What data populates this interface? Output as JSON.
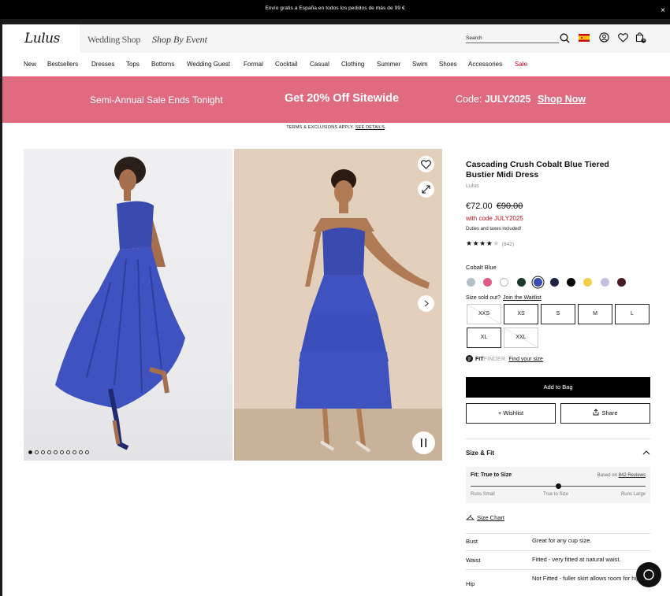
{
  "announcement": {
    "text": "Envío gratis a España en todos los pedidos de más de 99 €",
    "close": "×"
  },
  "header": {
    "logo": "Lulus",
    "tabs": [
      "Wedding Shop",
      "Shop By Event"
    ],
    "search_label": "Search",
    "bag_count": "0",
    "icons": [
      "search-icon",
      "spain-flag-icon",
      "account-icon",
      "heart-icon",
      "bag-icon"
    ]
  },
  "nav": [
    "New",
    "Bestsellers",
    "Dresses",
    "Tops",
    "Bottoms",
    "Wedding Guest",
    "Formal",
    "Cocktail",
    "Casual",
    "Clothing",
    "Summer",
    "Swim",
    "Shoes",
    "Accessories",
    "Sale"
  ],
  "promo": {
    "left": "Semi-Annual Sale Ends Tonight",
    "center": "Get 20% Off Sitewide",
    "code_label": "Code:",
    "code": "JULY2025",
    "cta": "Shop Now",
    "terms": "TERMS & EXCLUSIONS APPLY.",
    "terms_link": "SEE DETAILS"
  },
  "gallery": {
    "dot_count": 10,
    "active_dot": 0
  },
  "product": {
    "title": "Cascading Crush Cobalt Blue Tiered Bustier Midi Dress",
    "brand": "Lulus",
    "price": "€72.00",
    "original_price": "€90.00",
    "code_note": "with code JULY2025",
    "duties": "Duties and taxes included!",
    "stars": "★★★★★",
    "rating": 4,
    "review_count": "(842)",
    "color_name": "Cobalt Blue",
    "swatches": [
      "#b4c0c7",
      "#e05a8a",
      "#ffffff",
      "#1c3a2c",
      "#3a4bb0",
      "#1f2345",
      "#050505",
      "#f1cf48",
      "#c7bfe0",
      "#4a1a24"
    ],
    "selected_swatch": 4,
    "size_sold_out": "Size sold out?",
    "join_waitlist": "Join the Waitlist",
    "sizes": [
      {
        "label": "XXS",
        "available": false
      },
      {
        "label": "XS",
        "available": true
      },
      {
        "label": "S",
        "available": true
      },
      {
        "label": "M",
        "available": true
      },
      {
        "label": "L",
        "available": true
      },
      {
        "label": "XL",
        "available": true
      },
      {
        "label": "XXL",
        "available": false
      }
    ],
    "fit_brand": "FIT",
    "fit_finder": "FINDER",
    "find_size": "Find your size",
    "add_to_bag": "Add to Bag",
    "wishlist": "Wishlist",
    "share": "Share"
  },
  "size_fit": {
    "heading": "Size & Fit",
    "fit_title": "Fit: True to Size",
    "based_on": "Based on",
    "reviews_link": "842 Reviews",
    "scale": [
      "Runs Small",
      "True to Size",
      "Runs Large"
    ],
    "fit_position": 0.5,
    "size_chart": "Size Chart",
    "specs": [
      {
        "key": "Bust",
        "value": "Great for any cup size."
      },
      {
        "key": "Waist",
        "value": "Fitted - very fitted at natural waist."
      },
      {
        "key": "Hip",
        "value": "Not Fitted - fuller skirt allows room for hips."
      }
    ]
  }
}
